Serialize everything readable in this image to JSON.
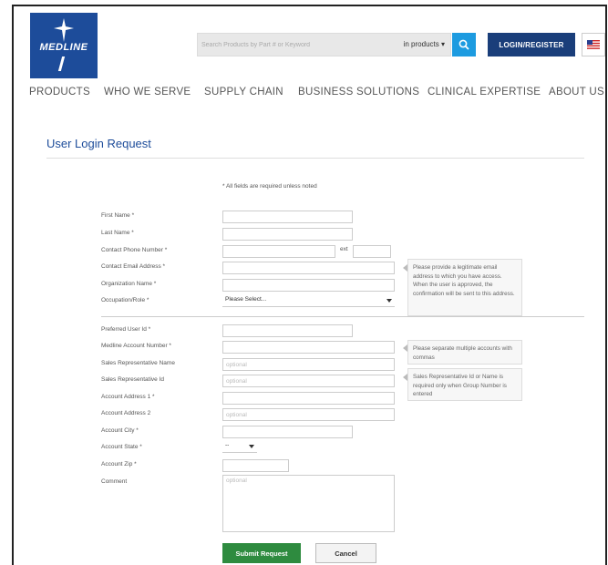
{
  "header": {
    "logo_text": "MEDLINE",
    "search_placeholder": "Search Products by Part # or Keyword",
    "search_scope": "in products",
    "login_label": "LOGIN/REGISTER"
  },
  "nav": {
    "items": [
      "PRODUCTS",
      "WHO WE SERVE",
      "SUPPLY CHAIN",
      "BUSINESS SOLUTIONS",
      "CLINICAL EXPERTISE",
      "ABOUT US"
    ]
  },
  "page": {
    "title": "User Login Request",
    "required_note": "* All fields are required unless noted"
  },
  "form": {
    "first_name": "First Name *",
    "last_name": "Last Name *",
    "phone": "Contact Phone Number *",
    "ext": "ext",
    "email": "Contact Email Address *",
    "org": "Organization Name *",
    "occupation": "Occupation/Role *",
    "occupation_value": "Please Select...",
    "user_id": "Preferred User Id *",
    "account_number": "Medline Account Number *",
    "rep_name": "Sales Representative Name",
    "rep_id": "Sales Representative Id",
    "address1": "Account Address 1 *",
    "address2": "Account Address 2",
    "city": "Account City *",
    "state": "Account State *",
    "state_value": "--",
    "zip": "Account Zip *",
    "comment": "Comment",
    "optional_placeholder": "optional"
  },
  "tips": {
    "email": "Please provide a legitimate email address to which you have access. When the user is approved, the confirmation will be sent to this address.",
    "accounts": "Please separate multiple accounts with commas",
    "rep": "Sales Representative Id or Name is required only when Group Number is entered"
  },
  "buttons": {
    "submit": "Submit Request",
    "cancel": "Cancel"
  },
  "colors": {
    "brand_blue": "#1d4c9a",
    "search_blue": "#1d9be0",
    "login_navy": "#1a3e7a",
    "submit_green": "#2e8b3f"
  }
}
